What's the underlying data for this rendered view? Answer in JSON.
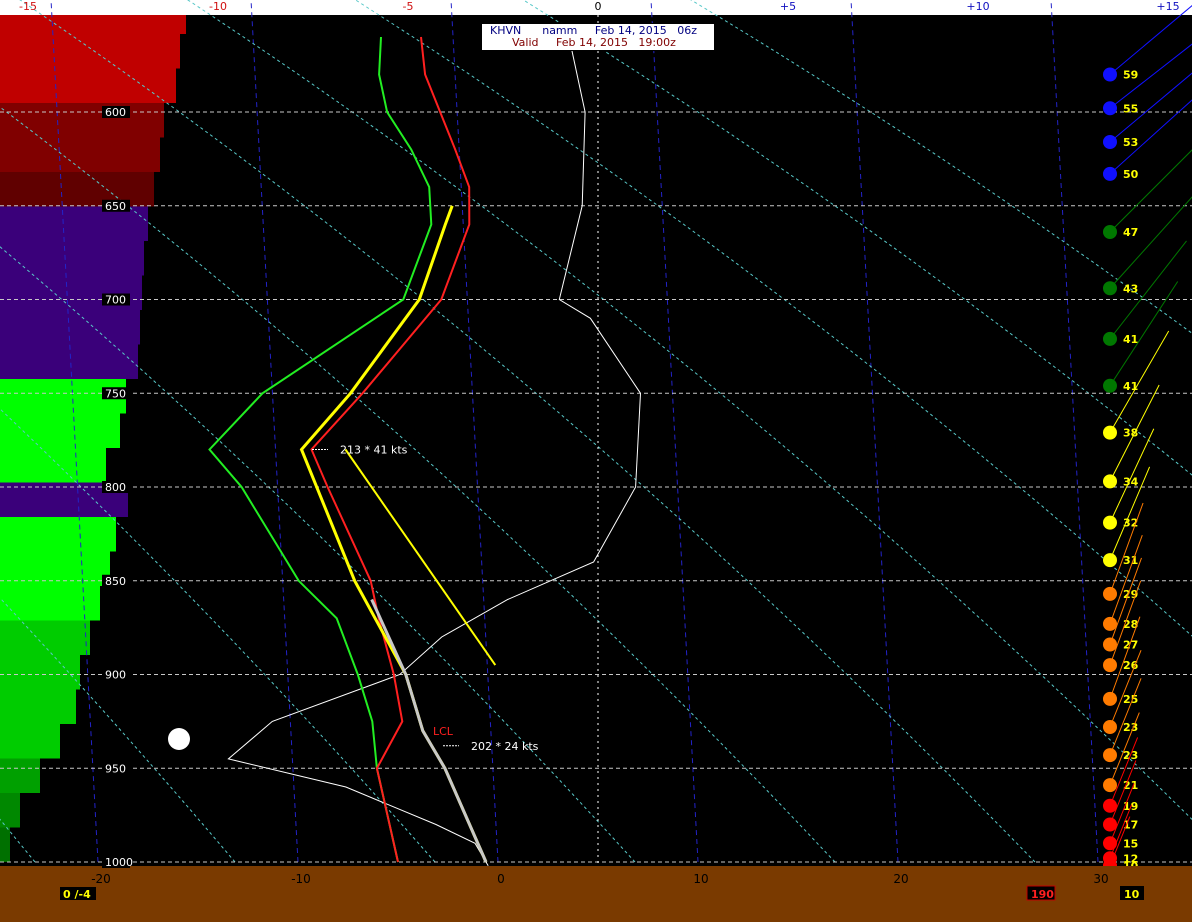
{
  "header": {
    "station_line": "KHVN      namm     Feb 14, 2015   06z",
    "valid_line": "Valid     Feb 14, 2015   19:00z"
  },
  "colors": {
    "background": "#000000",
    "ground": "#7a3a00",
    "temperature": "#ff2020",
    "dewpoint": "#22ee22",
    "parcel": "#ffff00",
    "wetbulb": "#c8c8c8",
    "virtual_temp": "#ffffff",
    "isotherm": "#2323c8",
    "dry_adiabat": "#58c8c8",
    "isobar": "#c8c8c8",
    "grid_text": "#ffffff"
  },
  "chart_data": {
    "type": "line",
    "title": "",
    "top_axis_ticks": [
      "-15",
      "-10",
      "-5",
      "0",
      "+5",
      "+10",
      "+15"
    ],
    "bottom_axis_ticks": [
      "-20",
      "-10",
      "0",
      "10",
      "20",
      "30"
    ],
    "pressure_levels": [
      "600",
      "650",
      "700",
      "750",
      "800",
      "850",
      "900",
      "950",
      "1000"
    ],
    "temperature_C": [
      [
        1000,
        -5.0
      ],
      [
        950,
        -5.8
      ],
      [
        925,
        -4.4
      ],
      [
        900,
        -4.7
      ],
      [
        870,
        -5.3
      ],
      [
        850,
        -5.6
      ],
      [
        800,
        -7.5
      ],
      [
        780,
        -8.2
      ],
      [
        750,
        -5.5
      ],
      [
        700,
        -1.3
      ],
      [
        660,
        0.3
      ],
      [
        640,
        0.4
      ],
      [
        620,
        -0.2
      ],
      [
        580,
        -1.5
      ],
      [
        560,
        -1.6
      ]
    ],
    "dewpoint_C": [
      [
        1000,
        -5.0
      ],
      [
        950,
        -5.8
      ],
      [
        925,
        -5.9
      ],
      [
        900,
        -6.5
      ],
      [
        870,
        -7.4
      ],
      [
        850,
        -9.2
      ],
      [
        800,
        -11.8
      ],
      [
        780,
        -13.3
      ],
      [
        750,
        -10.5
      ],
      [
        700,
        -3.2
      ],
      [
        660,
        -1.6
      ],
      [
        640,
        -1.6
      ],
      [
        620,
        -2.4
      ],
      [
        600,
        -3.5
      ],
      [
        580,
        -3.8
      ],
      [
        560,
        -3.6
      ]
    ],
    "parcel_C": [
      [
        1000,
        -0.6
      ],
      [
        950,
        -2.4
      ],
      [
        930,
        -3.4
      ],
      [
        900,
        -4.1
      ],
      [
        850,
        -6.4
      ],
      [
        780,
        -8.7
      ],
      [
        750,
        -6.1
      ],
      [
        700,
        -2.4
      ],
      [
        660,
        -0.9
      ],
      [
        650,
        -0.5
      ]
    ],
    "wetbulb_C": [
      [
        1000,
        -0.6
      ],
      [
        950,
        -2.4
      ],
      [
        930,
        -3.4
      ],
      [
        900,
        -4.1
      ],
      [
        860,
        -5.6
      ]
    ],
    "parcel2_C": [
      [
        895,
        0.4
      ],
      [
        780,
        -6.5
      ]
    ],
    "virtual_temp_C": [
      [
        1002,
        -0.5
      ],
      [
        990,
        -1.1
      ],
      [
        980,
        -3.0
      ],
      [
        960,
        -7.4
      ],
      [
        945,
        -13.2
      ],
      [
        925,
        -10.9
      ],
      [
        900,
        -4.4
      ],
      [
        880,
        -2.2
      ],
      [
        860,
        1.2
      ],
      [
        840,
        5.6
      ],
      [
        800,
        7.9
      ],
      [
        750,
        8.4
      ],
      [
        710,
        6.1
      ],
      [
        700,
        4.6
      ],
      [
        650,
        6.0
      ],
      [
        600,
        6.4
      ],
      [
        560,
        5.8
      ]
    ],
    "annotations": [
      {
        "text": "213 * 41 kts",
        "p": 780
      },
      {
        "text": "202 * 24 kts",
        "p": 938
      },
      {
        "text": "LCL",
        "p": 930
      }
    ],
    "wind_speeds_kts": [
      "59",
      "55",
      "53",
      "50",
      "47",
      "43",
      "41",
      "41",
      "38",
      "34",
      "32",
      "31",
      "29",
      "28",
      "27",
      "26",
      "25",
      "23",
      "23",
      "21",
      "19",
      "17",
      "15",
      "12",
      "10"
    ],
    "wind_dot_colors": [
      "#1010ff",
      "#1010ff",
      "#1010ff",
      "#1010ff",
      "#007800",
      "#007800",
      "#007800",
      "#007800",
      "#ffff00",
      "#ffff00",
      "#ffff00",
      "#ffff00",
      "#ff7b00",
      "#ff7b00",
      "#ff7b00",
      "#ff7b00",
      "#ff7b00",
      "#ff7b00",
      "#ff7b00",
      "#ff7b00",
      "#ff0000",
      "#ff0000",
      "#ff0000",
      "#ff0000",
      "#ff0000"
    ],
    "wind_barb_colors": [
      "#1010ff",
      "#1010ff",
      "#1010ff",
      "#1010ff",
      "#007800",
      "#007800",
      "#007800",
      "#007800",
      "#ffff00",
      "#ffff00",
      "#ffff00",
      "#ffff00",
      "#ff7b00",
      "#ff7b00",
      "#ff7b00",
      "#ff7b00",
      "#ff7b00",
      "#ff7b00",
      "#ff7b00",
      "#ff7b00",
      "#ff0000",
      "#ff0000",
      "#ff0000",
      "#ff0000",
      "#ff0000"
    ],
    "wind_direction_deg": [
      230,
      232,
      230,
      228,
      225,
      222,
      218,
      213,
      210,
      207,
      205,
      203,
      200,
      200,
      200,
      200,
      200,
      202,
      202,
      202,
      202,
      202,
      202,
      202,
      202
    ],
    "wind_pressures_hPa": [
      580,
      598,
      616,
      633,
      664,
      694,
      721,
      746,
      771,
      797,
      819,
      839,
      857,
      873,
      884,
      895,
      913,
      928,
      943,
      959,
      970,
      980,
      990,
      998,
      1002
    ],
    "left_profile_colors": [
      "#c00000",
      "#c00000",
      "#c00000",
      "#800000",
      "#800000",
      "#600000",
      "#3a007a",
      "#3a007a",
      "#3a007a",
      "#3a007a",
      "#3a007a",
      "#00ff00",
      "#00ff00",
      "#00ff00",
      "#3a007a",
      "#00ff00",
      "#00ff00",
      "#00ff00",
      "#00cc00",
      "#00cc00",
      "#00cc00",
      "#00cc00",
      "#00a000",
      "#008800",
      "#007000"
    ],
    "left_profile_values": [
      0.93,
      0.9,
      0.88,
      0.82,
      0.8,
      0.77,
      0.74,
      0.72,
      0.71,
      0.7,
      0.69,
      0.63,
      0.6,
      0.53,
      0.64,
      0.58,
      0.55,
      0.5,
      0.45,
      0.4,
      0.38,
      0.3,
      0.2,
      0.1,
      0.05
    ],
    "bottom_left_label": "0 /-4",
    "bottom_right_value": "190",
    "bottom_right_label": "10"
  }
}
